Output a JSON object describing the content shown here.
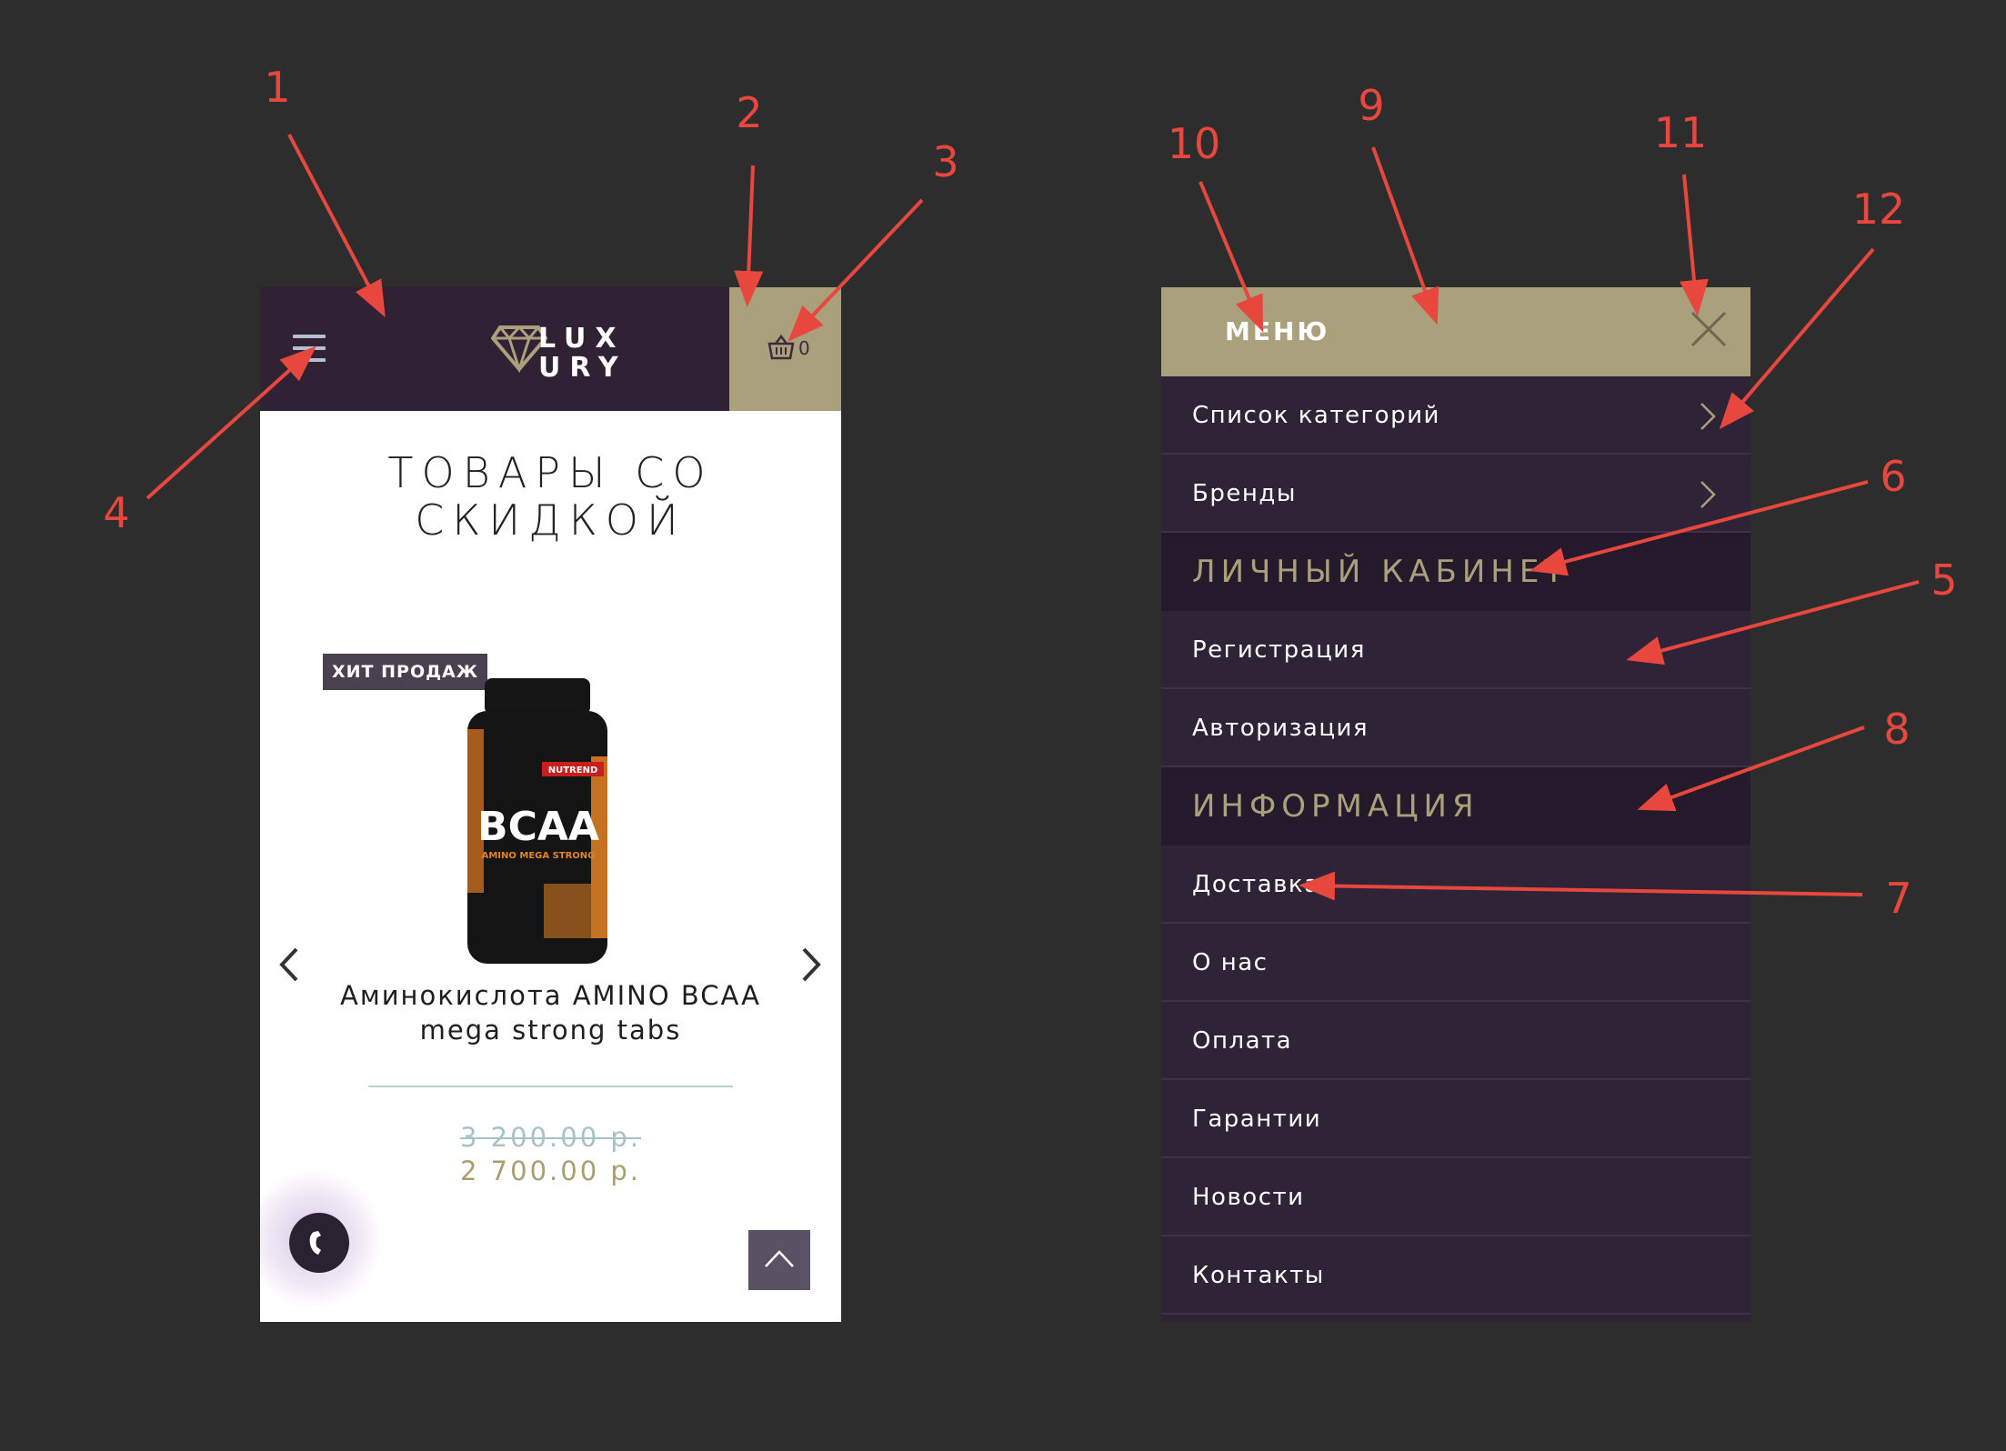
{
  "annotations": {
    "color": "#e8473d",
    "labels": [
      "1",
      "2",
      "3",
      "4",
      "5",
      "6",
      "7",
      "8",
      "9",
      "10",
      "11",
      "12"
    ]
  },
  "header": {
    "logo_line1": "LUX",
    "logo_line2": "URY",
    "cart_count": "0",
    "icons": [
      "hamburger-menu-icon",
      "diamond-logo-icon",
      "basket-icon"
    ]
  },
  "content": {
    "section_title": "ТОВАРЫ СО СКИДКОЙ",
    "badge": "ХИТ ПРОДАЖ",
    "product": {
      "image_label": "BCAA",
      "image_brand": "NUTREND",
      "image_subtitle": "AMINO MEGA STRONG",
      "name": "Аминокислота AMINO BCAA mega strong tabs",
      "old_price": "3 200.00 р.",
      "new_price": "2 700.00 р."
    },
    "icons": [
      "chevron-left-icon",
      "chevron-right-icon",
      "phone-icon",
      "chevron-up-icon"
    ]
  },
  "menu": {
    "title": "МЕНЮ",
    "top_items": [
      {
        "label": "Список категорий"
      },
      {
        "label": "Бренды"
      }
    ],
    "account_section": "ЛИЧНЫЙ КАБИНЕТ",
    "account_items": [
      {
        "label": "Регистрация"
      },
      {
        "label": "Авторизация"
      }
    ],
    "info_section": "ИНФОРМАЦИЯ",
    "info_items": [
      {
        "label": "Доставка"
      },
      {
        "label": "О нас"
      },
      {
        "label": "Оплата"
      },
      {
        "label": "Гарантии"
      },
      {
        "label": "Новости"
      },
      {
        "label": "Контакты"
      }
    ]
  },
  "colors": {
    "background": "#2d2d2d",
    "header_purple": "#302234",
    "gold": "#aba07c",
    "menu_bg": "#2f2437",
    "section_bg": "#251a2b",
    "old_price": "#a6c3c2",
    "new_price": "#ab9d70"
  }
}
